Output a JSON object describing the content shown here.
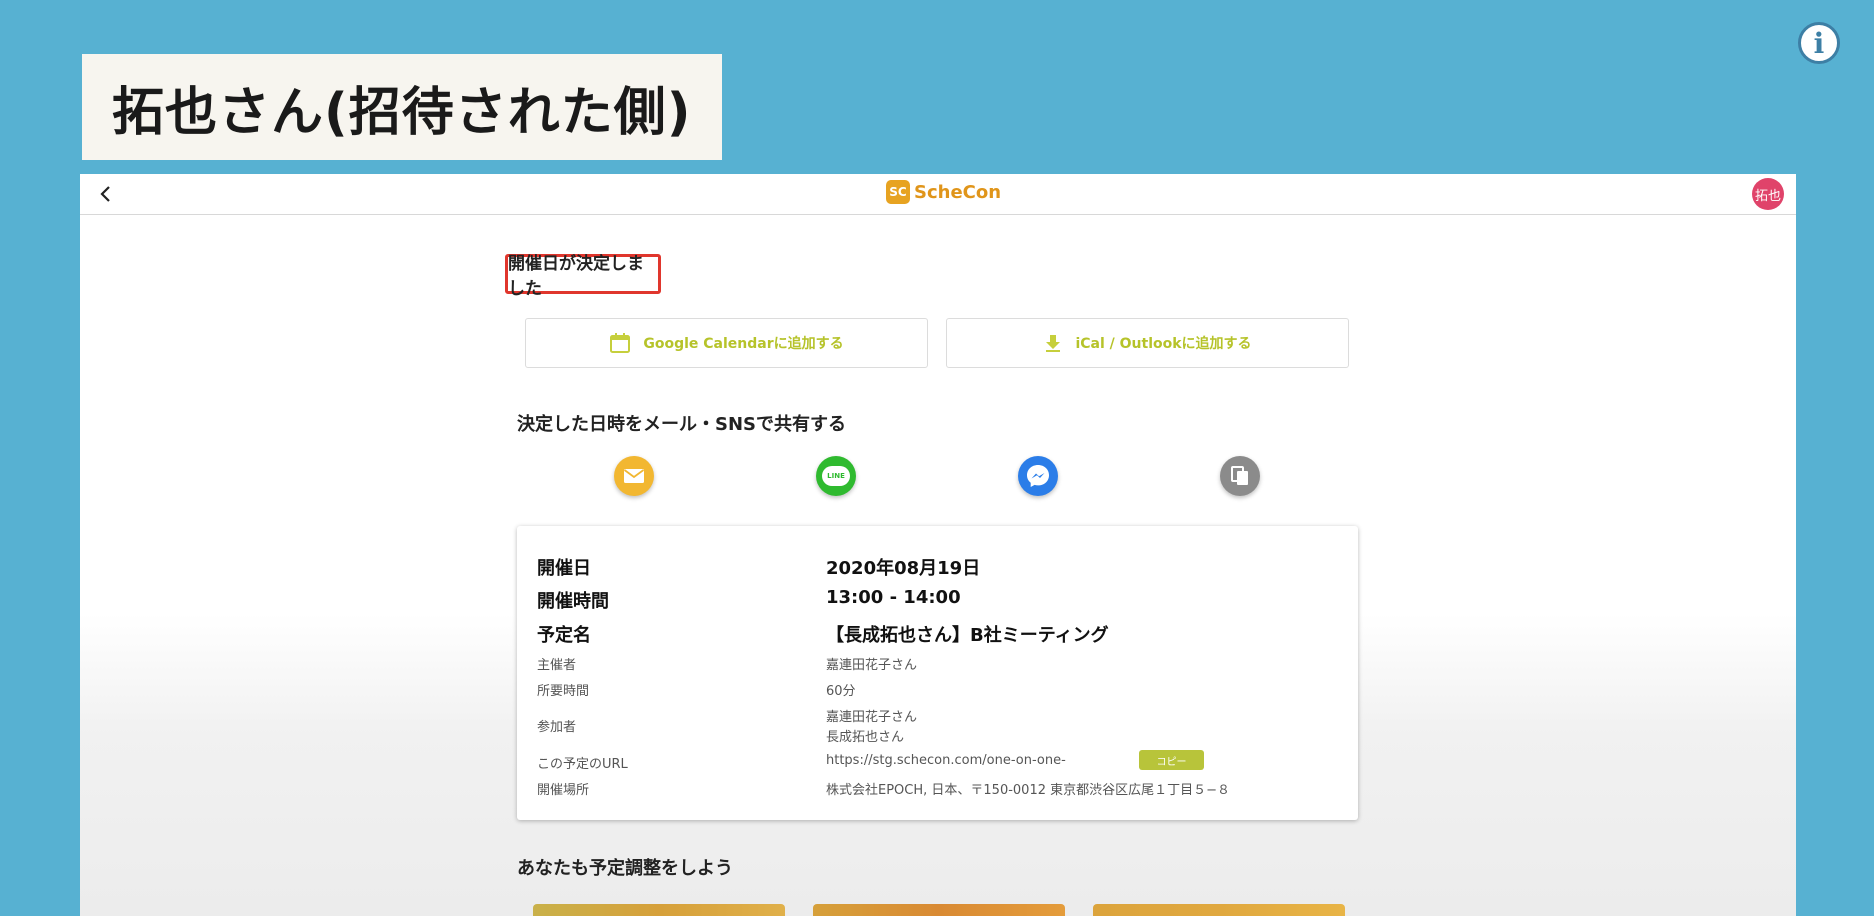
{
  "caption": {
    "title": "拓也さん(招待された側)"
  },
  "info": {
    "label": "i"
  },
  "header": {
    "logo_mark": "SC",
    "logo_text": "ScheCon",
    "avatar_text": "拓也"
  },
  "status": {
    "decided_label": "開催日が決定しました"
  },
  "calendar_buttons": {
    "google_label": "Google Calendarに追加する",
    "ical_label": "iCal / Outlookに追加する"
  },
  "share": {
    "heading": "決定した日時をメール・SNSで共有する",
    "icons": [
      "mail-icon",
      "line-icon",
      "messenger-icon",
      "copy-icon"
    ],
    "line_text": "LINE"
  },
  "details": {
    "date": {
      "label": "開催日",
      "value": "2020年08月19日"
    },
    "time": {
      "label": "開催時間",
      "value": "13:00 - 14:00"
    },
    "name": {
      "label": "予定名",
      "value": "【長成拓也さん】B社ミーティング"
    },
    "organizer": {
      "label": "主催者",
      "value": "嘉連田花子さん"
    },
    "duration": {
      "label": "所要時間",
      "value": "60分"
    },
    "participants": {
      "label": "参加者",
      "values": [
        "嘉連田花子さん",
        "長成拓也さん"
      ]
    },
    "url": {
      "label": "この予定のURL",
      "value": "https://stg.schecon.com/one-on-one-",
      "copy_label": "コピー"
    },
    "location": {
      "label": "開催場所",
      "value": "株式会社EPOCH, 日本、〒150-0012 東京都渋谷区広尾１丁目５−８"
    }
  },
  "promo": {
    "heading": "あなたも予定調整をしよう"
  },
  "colors": {
    "background": "#57b1d2",
    "accent": "#b6c32a",
    "decided_border": "#e0362d",
    "avatar": "#e0436a"
  }
}
